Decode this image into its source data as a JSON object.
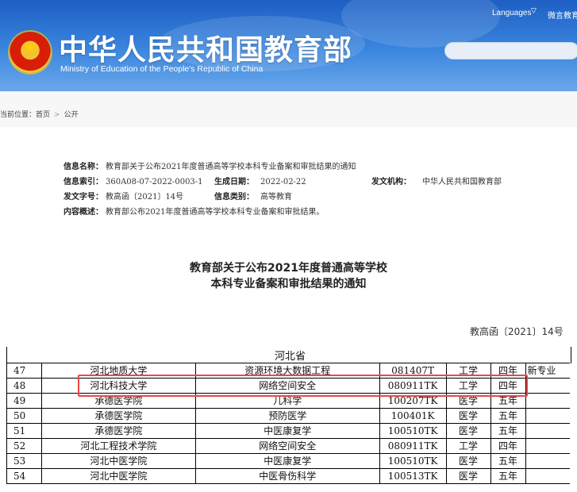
{
  "header": {
    "title": "中华人民共和国教育部",
    "subtitle": "Ministry of Education of the People's Republic of China",
    "languages_label": "Languages",
    "weibo_label": "微言教育",
    "emblem_glyph": "★"
  },
  "breadcrumb": {
    "label": "当前位置：",
    "items": [
      "首页",
      "公开"
    ],
    "separator": ">"
  },
  "meta": {
    "name_label": "信息名称：",
    "name_value": "教育部关于公布2021年度普通高等学校本科专业备案和审批结果的通知",
    "index_label": "信息索引：",
    "index_value": "360A08-07-2022-0003-1",
    "date_label": "生成日期：",
    "date_value": "2022-02-22",
    "agency_label": "发文机构：",
    "agency_value": "中华人民共和国教育部",
    "docno_label": "发文字号：",
    "docno_value": "教高函〔2021〕14号",
    "category_label": "信息类别：",
    "category_value": "高等教育",
    "summary_label": "内容概述：",
    "summary_value": "教育部公布2021年度普通高等学校本科专业备案和审批结果。"
  },
  "document": {
    "title_line1": "教育部关于公布2021年度普通高等学校",
    "title_line2": "本科专业备案和审批结果的通知",
    "number": "教高函〔2021〕14号"
  },
  "table": {
    "province": "河北省",
    "rows": [
      {
        "no": "47",
        "school": "河北地质大学",
        "major": "资源环境大数据工程",
        "code": "081407T",
        "field": "工学",
        "years": "四年",
        "note": "新专业"
      },
      {
        "no": "48",
        "school": "河北科技大学",
        "major": "网络空间安全",
        "code": "080911TK",
        "field": "工学",
        "years": "四年",
        "note": ""
      },
      {
        "no": "49",
        "school": "承德医学院",
        "major": "儿科学",
        "code": "100207TK",
        "field": "医学",
        "years": "五年",
        "note": ""
      },
      {
        "no": "50",
        "school": "承德医学院",
        "major": "预防医学",
        "code": "100401K",
        "field": "医学",
        "years": "五年",
        "note": ""
      },
      {
        "no": "51",
        "school": "承德医学院",
        "major": "中医康复学",
        "code": "100510TK",
        "field": "医学",
        "years": "五年",
        "note": ""
      },
      {
        "no": "52",
        "school": "河北工程技术学院",
        "major": "网络空间安全",
        "code": "080911TK",
        "field": "工学",
        "years": "四年",
        "note": ""
      },
      {
        "no": "53",
        "school": "河北中医学院",
        "major": "中医康复学",
        "code": "100510TK",
        "field": "医学",
        "years": "五年",
        "note": ""
      },
      {
        "no": "54",
        "school": "河北中医学院",
        "major": "中医骨伤科学",
        "code": "100513TK",
        "field": "医学",
        "years": "五年",
        "note": ""
      }
    ]
  },
  "colors": {
    "banner": "#2f74d4",
    "highlight": "#e34a4a"
  }
}
